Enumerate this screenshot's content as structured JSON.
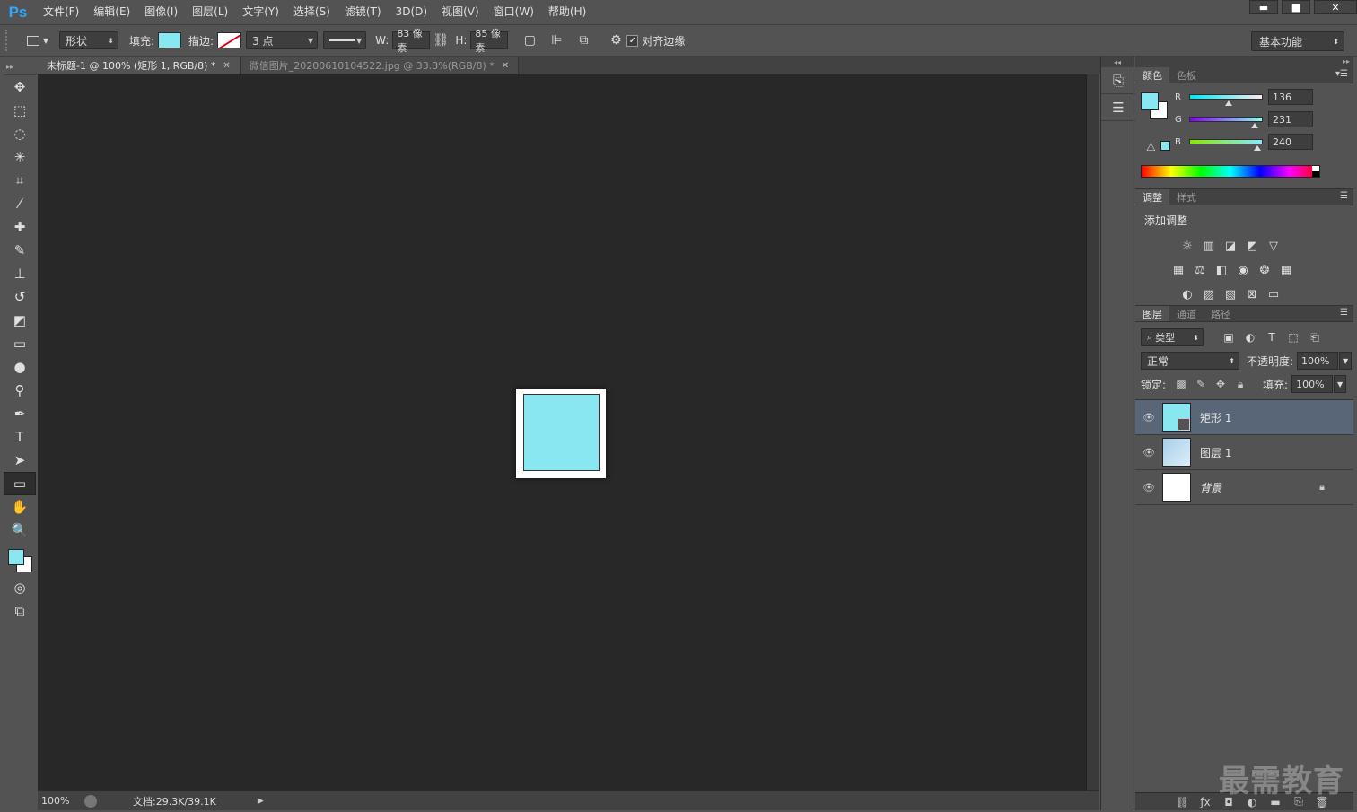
{
  "app": {
    "logo": "Ps"
  },
  "menu": [
    "文件(F)",
    "编辑(E)",
    "图像(I)",
    "图层(L)",
    "文字(Y)",
    "选择(S)",
    "滤镜(T)",
    "3D(D)",
    "视图(V)",
    "窗口(W)",
    "帮助(H)"
  ],
  "window": {
    "minimize": "▬",
    "maximize": "■",
    "close": "✕"
  },
  "options": {
    "mode": "形状",
    "fill_label": "填充:",
    "stroke_label": "描边:",
    "stroke_width": "3 点",
    "w_label": "W:",
    "w_value": "83 像素",
    "h_label": "H:",
    "h_value": "85 像素",
    "align_edges": "对齐边缘",
    "fill_color": "#88e7f0",
    "workspace": "基本功能"
  },
  "tabs": [
    {
      "title": "未标题-1 @ 100% (矩形 1, RGB/8) *",
      "active": true
    },
    {
      "title": "微信图片_20200610104522.jpg @ 33.3%(RGB/8) *",
      "active": false
    }
  ],
  "status": {
    "zoom": "100%",
    "doc": "文档:29.3K/39.1K"
  },
  "color_panel": {
    "tabs": [
      "颜色",
      "色板"
    ],
    "channels": [
      {
        "name": "R",
        "value": "136",
        "fraction": 0.533,
        "gradient": "linear-gradient(to right,#00e7f0,#ffe7f0)"
      },
      {
        "name": "G",
        "value": "231",
        "fraction": 0.906,
        "gradient": "linear-gradient(to right,#8800f0,#88fff0)"
      },
      {
        "name": "B",
        "value": "240",
        "fraction": 0.941,
        "gradient": "linear-gradient(to right,#88e700,#88e7ff)"
      }
    ]
  },
  "adjust_panel": {
    "tabs": [
      "调整",
      "样式"
    ],
    "title": "添加调整"
  },
  "layers_panel": {
    "tabs": [
      "图层",
      "通道",
      "路径"
    ],
    "filter": "类型",
    "blend": "正常",
    "opacity_label": "不透明度:",
    "opacity": "100%",
    "lock_label": "锁定:",
    "fill_label": "填充:",
    "fill": "100%",
    "layers": [
      {
        "name": "矩形 1",
        "type": "shape",
        "selected": true
      },
      {
        "name": "图层 1",
        "type": "raster",
        "selected": false
      },
      {
        "name": "背景",
        "type": "background",
        "selected": false
      }
    ]
  },
  "watermark": "最需教育"
}
